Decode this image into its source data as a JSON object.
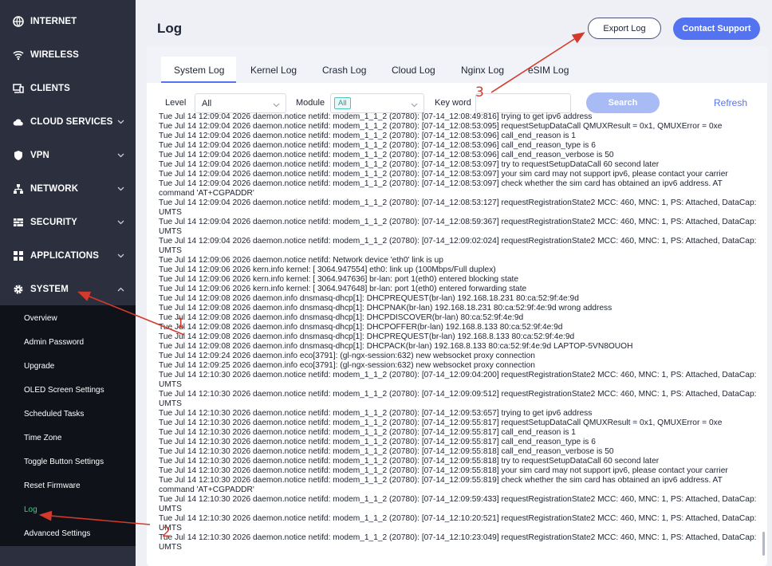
{
  "sidebar": {
    "items": [
      {
        "label": "INTERNET",
        "icon": "globe-icon",
        "has_chevron": false
      },
      {
        "label": "WIRELESS",
        "icon": "wifi-icon",
        "has_chevron": false
      },
      {
        "label": "CLIENTS",
        "icon": "devices-icon",
        "has_chevron": false
      },
      {
        "label": "CLOUD SERVICES",
        "icon": "cloud-icon",
        "has_chevron": true
      },
      {
        "label": "VPN",
        "icon": "shield-icon",
        "has_chevron": true
      },
      {
        "label": "NETWORK",
        "icon": "network-icon",
        "has_chevron": true
      },
      {
        "label": "SECURITY",
        "icon": "firewall-icon",
        "has_chevron": true
      },
      {
        "label": "APPLICATIONS",
        "icon": "apps-icon",
        "has_chevron": true
      },
      {
        "label": "SYSTEM",
        "icon": "gear-icon",
        "has_chevron": true,
        "expanded": true
      }
    ],
    "submenu": [
      "Overview",
      "Admin Password",
      "Upgrade",
      "OLED Screen Settings",
      "Scheduled Tasks",
      "Time Zone",
      "Toggle Button Settings",
      "Reset Firmware",
      "Log",
      "Advanced Settings"
    ],
    "active_submenu": "Log"
  },
  "header": {
    "title": "Log",
    "export_label": "Export Log",
    "support_label": "Contact Support"
  },
  "tabs": [
    "System Log",
    "Kernel Log",
    "Crash Log",
    "Cloud Log",
    "Nginx Log",
    "eSIM Log"
  ],
  "active_tab": "System Log",
  "filters": {
    "level_label": "Level",
    "level_value": "All",
    "module_label": "Module",
    "module_value": "All",
    "keyword_label": "Key word",
    "keyword_value": "",
    "search_label": "Search",
    "refresh_label": "Refresh"
  },
  "log_lines": [
    "Tue Jul 14 12:09:04 2026 daemon.notice netifd: modem_1_1_2 (20780): [07-14_12:08:49:816] trying to get ipv6 address",
    "Tue Jul 14 12:09:04 2026 daemon.notice netifd: modem_1_1_2 (20780): [07-14_12:08:53:095] requestSetupDataCall QMUXResult = 0x1, QMUXError = 0xe",
    "Tue Jul 14 12:09:04 2026 daemon.notice netifd: modem_1_1_2 (20780): [07-14_12:08:53:096] call_end_reason is 1",
    "Tue Jul 14 12:09:04 2026 daemon.notice netifd: modem_1_1_2 (20780): [07-14_12:08:53:096] call_end_reason_type is 6",
    "Tue Jul 14 12:09:04 2026 daemon.notice netifd: modem_1_1_2 (20780): [07-14_12:08:53:096] call_end_reason_verbose is 50",
    "Tue Jul 14 12:09:04 2026 daemon.notice netifd: modem_1_1_2 (20780): [07-14_12:08:53:097] try to requestSetupDataCall 60 second later",
    "Tue Jul 14 12:09:04 2026 daemon.notice netifd: modem_1_1_2 (20780): [07-14_12:08:53:097] your sim card may not support ipv6, please contact your carrier",
    "Tue Jul 14 12:09:04 2026 daemon.notice netifd: modem_1_1_2 (20780): [07-14_12:08:53:097] check whether the sim card has obtained an ipv6 address. AT command 'AT+CGPADDR'",
    "Tue Jul 14 12:09:04 2026 daemon.notice netifd: modem_1_1_2 (20780): [07-14_12:08:53:127] requestRegistrationState2 MCC: 460, MNC: 1, PS: Attached, DataCap: UMTS",
    "Tue Jul 14 12:09:04 2026 daemon.notice netifd: modem_1_1_2 (20780): [07-14_12:08:59:367] requestRegistrationState2 MCC: 460, MNC: 1, PS: Attached, DataCap: UMTS",
    "Tue Jul 14 12:09:04 2026 daemon.notice netifd: modem_1_1_2 (20780): [07-14_12:09:02:024] requestRegistrationState2 MCC: 460, MNC: 1, PS: Attached, DataCap: UMTS",
    "Tue Jul 14 12:09:06 2026 daemon.notice netifd: Network device 'eth0' link is up",
    "Tue Jul 14 12:09:06 2026 kern.info kernel: [ 3064.947554] eth0: link up (100Mbps/Full duplex)",
    "Tue Jul 14 12:09:06 2026 kern.info kernel: [ 3064.947636] br-lan: port 1(eth0) entered blocking state",
    "Tue Jul 14 12:09:06 2026 kern.info kernel: [ 3064.947648] br-lan: port 1(eth0) entered forwarding state",
    "Tue Jul 14 12:09:08 2026 daemon.info dnsmasq-dhcp[1]: DHCPREQUEST(br-lan) 192.168.18.231 80:ca:52:9f:4e:9d",
    "Tue Jul 14 12:09:08 2026 daemon.info dnsmasq-dhcp[1]: DHCPNAK(br-lan) 192.168.18.231 80:ca:52:9f:4e:9d wrong address",
    "Tue Jul 14 12:09:08 2026 daemon.info dnsmasq-dhcp[1]: DHCPDISCOVER(br-lan) 80:ca:52:9f:4e:9d",
    "Tue Jul 14 12:09:08 2026 daemon.info dnsmasq-dhcp[1]: DHCPOFFER(br-lan) 192.168.8.133 80:ca:52:9f:4e:9d",
    "Tue Jul 14 12:09:08 2026 daemon.info dnsmasq-dhcp[1]: DHCPREQUEST(br-lan) 192.168.8.133 80:ca:52:9f:4e:9d",
    "Tue Jul 14 12:09:08 2026 daemon.info dnsmasq-dhcp[1]: DHCPACK(br-lan) 192.168.8.133 80:ca:52:9f:4e:9d LAPTOP-5VN8OUOH",
    "Tue Jul 14 12:09:24 2026 daemon.info eco[3791]: (gl-ngx-session:632) new websocket proxy connection",
    "Tue Jul 14 12:09:25 2026 daemon.info eco[3791]: (gl-ngx-session:632) new websocket proxy connection",
    "Tue Jul 14 12:10:30 2026 daemon.notice netifd: modem_1_1_2 (20780): [07-14_12:09:04:200] requestRegistrationState2 MCC: 460, MNC: 1, PS: Attached, DataCap: UMTS",
    "Tue Jul 14 12:10:30 2026 daemon.notice netifd: modem_1_1_2 (20780): [07-14_12:09:09:512] requestRegistrationState2 MCC: 460, MNC: 1, PS: Attached, DataCap: UMTS",
    "Tue Jul 14 12:10:30 2026 daemon.notice netifd: modem_1_1_2 (20780): [07-14_12:09:53:657] trying to get ipv6 address",
    "Tue Jul 14 12:10:30 2026 daemon.notice netifd: modem_1_1_2 (20780): [07-14_12:09:55:817] requestSetupDataCall QMUXResult = 0x1, QMUXError = 0xe",
    "Tue Jul 14 12:10:30 2026 daemon.notice netifd: modem_1_1_2 (20780): [07-14_12:09:55:817] call_end_reason is 1",
    "Tue Jul 14 12:10:30 2026 daemon.notice netifd: modem_1_1_2 (20780): [07-14_12:09:55:817] call_end_reason_type is 6",
    "Tue Jul 14 12:10:30 2026 daemon.notice netifd: modem_1_1_2 (20780): [07-14_12:09:55:818] call_end_reason_verbose is 50",
    "Tue Jul 14 12:10:30 2026 daemon.notice netifd: modem_1_1_2 (20780): [07-14_12:09:55:818] try to requestSetupDataCall 60 second later",
    "Tue Jul 14 12:10:30 2026 daemon.notice netifd: modem_1_1_2 (20780): [07-14_12:09:55:818] your sim card may not support ipv6, please contact your carrier",
    "Tue Jul 14 12:10:30 2026 daemon.notice netifd: modem_1_1_2 (20780): [07-14_12:09:55:819] check whether the sim card has obtained an ipv6 address. AT command 'AT+CGPADDR'",
    "Tue Jul 14 12:10:30 2026 daemon.notice netifd: modem_1_1_2 (20780): [07-14_12:09:59:433] requestRegistrationState2 MCC: 460, MNC: 1, PS: Attached, DataCap: UMTS",
    "Tue Jul 14 12:10:30 2026 daemon.notice netifd: modem_1_1_2 (20780): [07-14_12:10:20:521] requestRegistrationState2 MCC: 460, MNC: 1, PS: Attached, DataCap: UMTS",
    "Tue Jul 14 12:10:30 2026 daemon.notice netifd: modem_1_1_2 (20780): [07-14_12:10:23:049] requestRegistrationState2 MCC: 460, MNC: 1, PS: Attached, DataCap: UMTS"
  ],
  "annotations": {
    "marker_1": "1",
    "marker_2": "2",
    "marker_3": "3",
    "color": "#d33a2c"
  },
  "colors": {
    "sidebar_bg": "#2b2f3e",
    "submenu_bg": "#10121a",
    "active_green": "#35d07f",
    "accent_blue": "#5473f0"
  }
}
